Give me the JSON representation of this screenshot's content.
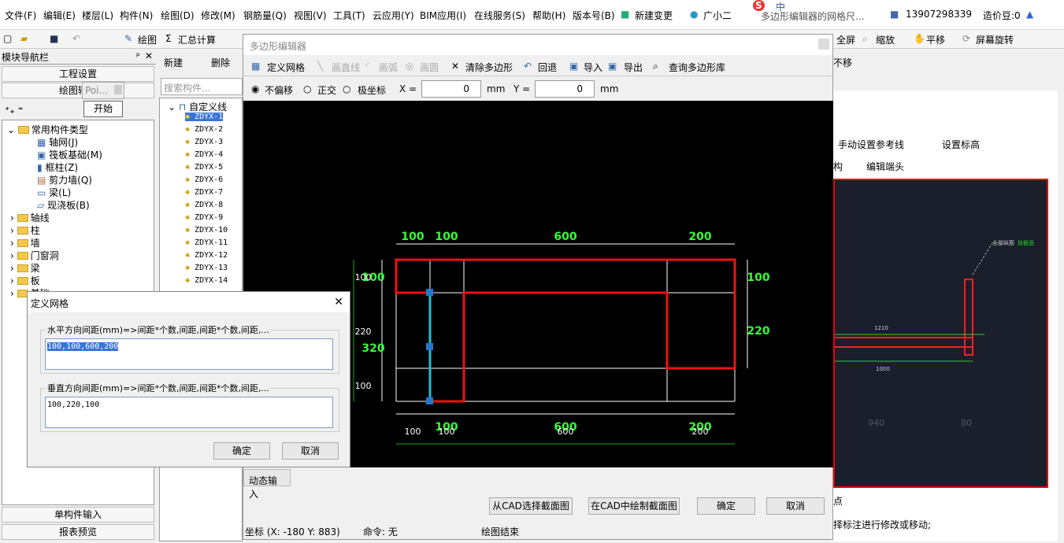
{
  "menu": [
    "文件(F)",
    "编辑(E)",
    "楼层(L)",
    "构件(N)",
    "绘图(D)",
    "修改(M)",
    "钢筋量(Q)",
    "视图(V)",
    "工具(T)",
    "云应用(Y)",
    "BIM应用(I)",
    "在线服务(S)",
    "帮助(H)",
    "版本号(B)",
    "新建变更",
    "广小二"
  ],
  "title_right": "多边形编辑器的网格尺...",
  "phone": "13907298339",
  "bean": "造价豆:0",
  "ime": "中",
  "toolbar": {
    "draw": "绘图",
    "sum": "汇总计算",
    "fullscreen": "全屏",
    "zoom": "缩放",
    "pan": "平移",
    "rotate": "屏幕旋转",
    "nomove": "不移"
  },
  "nav": {
    "title": "模块导航栏",
    "project": "工程设置",
    "drawing": "绘图输",
    "single": "单构件输入",
    "report": "报表预览",
    "poi": "Poi...",
    "start": "开始"
  },
  "tree": {
    "root": "常用构件类型",
    "items": [
      "轴网(J)",
      "筏板基础(M)",
      "框柱(Z)",
      "剪力墙(Q)",
      "梁(L)",
      "现浇板(B)"
    ],
    "folders": [
      "轴线",
      "柱",
      "墙",
      "门窗洞",
      "梁",
      "板",
      "基础"
    ]
  },
  "list": {
    "new": "新建",
    "del": "删除",
    "search": "搜索构件...",
    "root": "自定义线",
    "items": [
      "ZDYX-1",
      "ZDYX-2",
      "ZDYX-3",
      "ZDYX-4",
      "ZDYX-5",
      "ZDYX-6",
      "ZDYX-7",
      "ZDYX-8",
      "ZDYX-9",
      "ZDYX-10",
      "ZDYX-11",
      "ZDYX-12",
      "ZDYX-13",
      "ZDYX-14"
    ]
  },
  "pe": {
    "title": "多边形编辑器",
    "grid": "定义网格",
    "line": "画直线",
    "arc": "画弧",
    "circle": "画圆",
    "clear": "清除多边形",
    "undo": "回退",
    "import": "导入",
    "export": "导出",
    "lib": "查询多边形库",
    "nooffset": "不偏移",
    "ortho": "正交",
    "polar": "极坐标",
    "x_label": "X =",
    "x_val": "0",
    "y_label": "Y =",
    "y_val": "0",
    "unit": "mm",
    "dyn": "动态输入",
    "from_cad": "从CAD选择截面图",
    "in_cad": "在CAD中绘制截面图",
    "ok": "确定",
    "cancel": "取消",
    "coord": "坐标 (X: -180 Y: 883)",
    "cmd": "命令: 无",
    "end": "绘图结束"
  },
  "dims": {
    "top": [
      "100",
      "100",
      "600",
      "200"
    ],
    "bottom": [
      "100",
      "600",
      "200"
    ],
    "bottom_w": [
      "100",
      "100",
      "600",
      "200"
    ],
    "left": [
      "100",
      "220",
      "100"
    ],
    "left_total": "320",
    "right": [
      "100",
      "220"
    ]
  },
  "dlg": {
    "title": "定义网格",
    "h_label": "水平方向间距(mm)=>间距*个数,间距,间距*个数,间距,...",
    "h_val": "100,100,600,200",
    "v_label": "垂直方向间距(mm)=>间距*个数,间距,间距*个数,间距,...",
    "v_val": "100,220,100",
    "ok": "确定",
    "cancel": "取消"
  },
  "right": {
    "ref": "手动设置参考线",
    "elev": "设置标高",
    "struct": "构",
    "edit": "编辑端头",
    "all": "全部纵筋",
    "mark": "按截面",
    "d940": "940",
    "d80": "80",
    "d1000": "1000",
    "d1210": "1210",
    "tip": "择标注进行修改或移动;",
    "pt": "点"
  }
}
